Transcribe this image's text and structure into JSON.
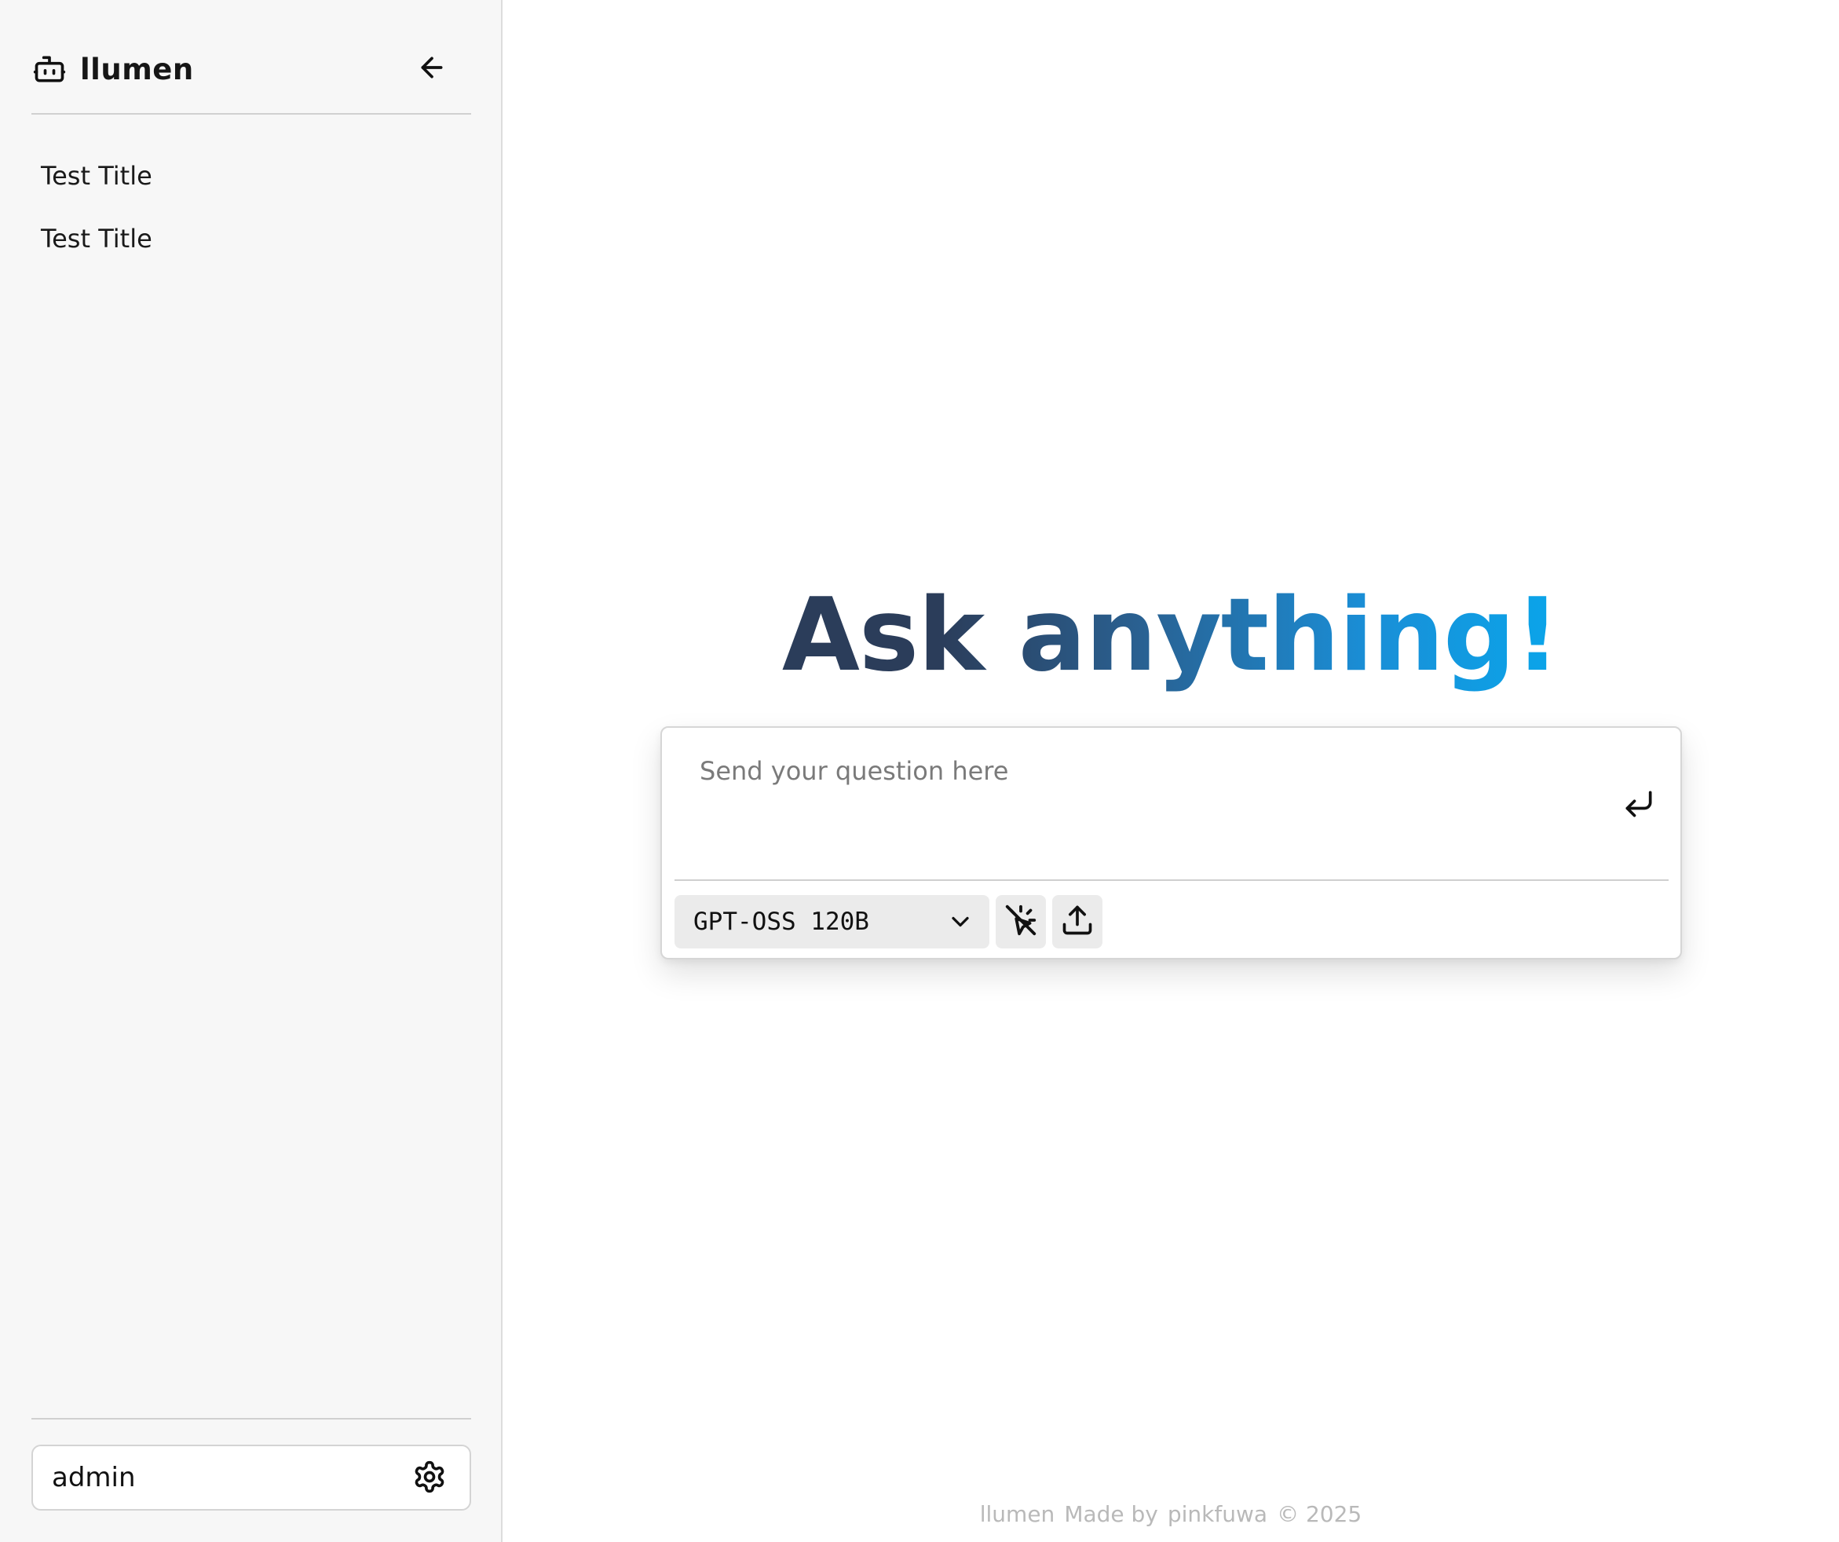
{
  "app": {
    "brand_name": "llumen",
    "brand_icon": "robot-icon"
  },
  "sidebar": {
    "collapse_icon": "arrow-left-icon",
    "items": [
      {
        "label": "Test Title"
      },
      {
        "label": "Test Title"
      }
    ],
    "user": {
      "name": "admin",
      "settings_icon": "gear-icon"
    }
  },
  "main": {
    "hero_title": "Ask anything!",
    "composer": {
      "placeholder": "Send your question here",
      "value": "",
      "send_icon": "enter-return-icon",
      "model": {
        "selected": "GPT-OSS 120B",
        "chevron_icon": "chevron-down-icon"
      },
      "tools": {
        "search_toggle_icon": "search-off-icon",
        "upload_icon": "upload-icon"
      }
    },
    "footer": {
      "brand": "llumen",
      "made_by": "Made by",
      "author": "pinkfuwa",
      "copyright": "© 2025"
    }
  },
  "colors": {
    "sidebar_bg": "#f7f7f7",
    "title_gradient_start": "#2b3d5a",
    "title_gradient_end": "#0aa5ea",
    "tool_button_bg": "#ebebeb",
    "footer_text": "#b9b9b9"
  }
}
